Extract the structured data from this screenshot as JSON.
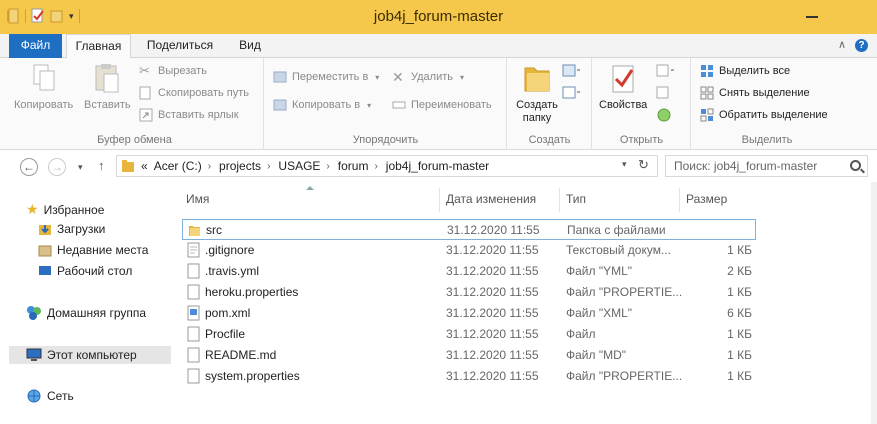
{
  "window": {
    "title": "job4j_forum-master"
  },
  "tabs": {
    "file": "Файл",
    "home": "Главная",
    "share": "Поделиться",
    "view": "Вид"
  },
  "ribbon": {
    "clipboard": {
      "label": "Буфер обмена",
      "copy": "Копировать",
      "paste": "Вставить",
      "cut": "Вырезать",
      "copy_path": "Скопировать путь",
      "paste_shortcut": "Вставить ярлык"
    },
    "organize": {
      "label": "Упорядочить",
      "move_to": "Переместить в",
      "copy_to": "Копировать в",
      "delete": "Удалить",
      "rename": "Переименовать"
    },
    "create": {
      "label": "Создать",
      "new_folder": "Создать папку"
    },
    "open": {
      "label": "Открыть",
      "properties": "Свойства"
    },
    "select": {
      "label": "Выделить",
      "select_all": "Выделить все",
      "select_none": "Снять выделение",
      "invert": "Обратить выделение"
    }
  },
  "address": {
    "overflow": "«",
    "crumbs": [
      "Acer (C:)",
      "projects",
      "USAGE",
      "forum",
      "job4j_forum-master"
    ]
  },
  "search": {
    "placeholder": "Поиск: job4j_forum-master"
  },
  "nav": {
    "favorites": "Избранное",
    "downloads": "Загрузки",
    "recent": "Недавние места",
    "desktop": "Рабочий стол",
    "homegroup": "Домашняя группа",
    "computer": "Этот компьютер",
    "network": "Сеть"
  },
  "columns": {
    "name": "Имя",
    "date": "Дата изменения",
    "type": "Тип",
    "size": "Размер"
  },
  "files": [
    {
      "name": "src",
      "date": "31.12.2020 11:55",
      "type": "Папка с файлами",
      "size": "",
      "icon": "folder-icon"
    },
    {
      "name": ".gitignore",
      "date": "31.12.2020 11:55",
      "type": "Текстовый докум...",
      "size": "1 КБ",
      "icon": "text-file-icon"
    },
    {
      "name": ".travis.yml",
      "date": "31.12.2020 11:55",
      "type": "Файл \"YML\"",
      "size": "2 КБ",
      "icon": "file-icon"
    },
    {
      "name": "heroku.properties",
      "date": "31.12.2020 11:55",
      "type": "Файл \"PROPERTIE...",
      "size": "1 КБ",
      "icon": "file-icon"
    },
    {
      "name": "pom.xml",
      "date": "31.12.2020 11:55",
      "type": "Файл \"XML\"",
      "size": "6 КБ",
      "icon": "xml-file-icon"
    },
    {
      "name": "Procfile",
      "date": "31.12.2020 11:55",
      "type": "Файл",
      "size": "1 КБ",
      "icon": "file-icon"
    },
    {
      "name": "README.md",
      "date": "31.12.2020 11:55",
      "type": "Файл \"MD\"",
      "size": "1 КБ",
      "icon": "file-icon"
    },
    {
      "name": "system.properties",
      "date": "31.12.2020 11:55",
      "type": "Файл \"PROPERTIE...",
      "size": "1 КБ",
      "icon": "file-icon"
    }
  ],
  "colors": {
    "accent": "#1e6fc2",
    "titlebar": "#f5c84c",
    "folder": "#e8b53c"
  }
}
